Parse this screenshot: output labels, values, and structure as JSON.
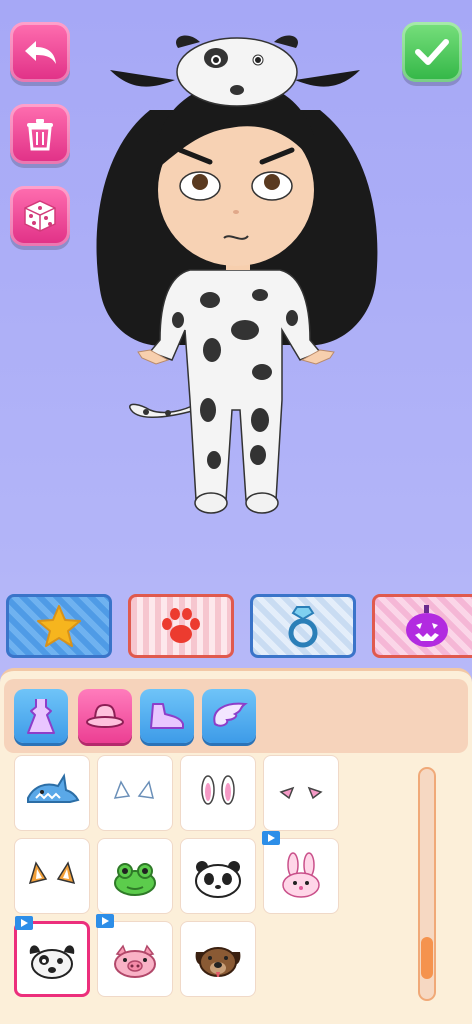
{
  "toolbar": {
    "back_icon": "back-arrow-icon",
    "delete_icon": "trash-icon",
    "random_icon": "dice-icon",
    "confirm_icon": "checkmark-icon"
  },
  "categories": [
    {
      "icon": "star-icon",
      "selected": true
    },
    {
      "icon": "paw-icon",
      "selected": false
    },
    {
      "icon": "ring-icon",
      "selected": false
    },
    {
      "icon": "pumpkin-icon",
      "selected": false
    }
  ],
  "tabs": [
    {
      "icon": "dress-icon",
      "active": false
    },
    {
      "icon": "hat-icon",
      "active": true
    },
    {
      "icon": "shoe-icon",
      "active": false
    },
    {
      "icon": "wing-icon",
      "active": false
    }
  ],
  "items": [
    {
      "icon": "shark-hat-icon",
      "video": false,
      "selected": false
    },
    {
      "icon": "white-ears-icon",
      "video": false,
      "selected": false
    },
    {
      "icon": "bunny-ears-icon",
      "video": false,
      "selected": false
    },
    {
      "icon": "pink-ears-icon",
      "video": false,
      "selected": false
    },
    {
      "icon": "fox-ears-icon",
      "video": false,
      "selected": false
    },
    {
      "icon": "frog-hat-icon",
      "video": false,
      "selected": false
    },
    {
      "icon": "panda-hat-icon",
      "video": false,
      "selected": false
    },
    {
      "icon": "rabbit-hat-icon",
      "video": true,
      "selected": false
    },
    {
      "icon": "dalmatian-hat-icon",
      "video": true,
      "selected": true
    },
    {
      "icon": "pig-hat-icon",
      "video": true,
      "selected": false
    },
    {
      "icon": "puppy-hat-icon",
      "video": false,
      "selected": false
    }
  ],
  "colors": {
    "background": "#a6a8f6",
    "accent_pink": "#ec3f93",
    "accent_green": "#32b646",
    "panel": "#fcefd9"
  },
  "scroll_position": 0.9
}
